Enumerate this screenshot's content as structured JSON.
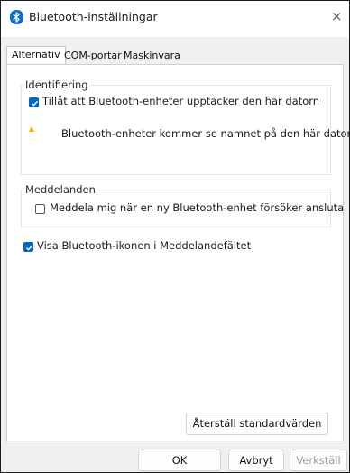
{
  "window": {
    "title": "Bluetooth-inställningar",
    "close_glyph": "×"
  },
  "tabs": [
    {
      "label": "Alternativ",
      "active": true
    },
    {
      "label": "COM-portar",
      "active": false
    },
    {
      "label": "Maskinvara",
      "active": false
    }
  ],
  "identification": {
    "group_title": "Identifiering",
    "allow_discovery_label": "Tillåt att Bluetooth-enheter upptäcker den här datorn",
    "allow_discovery_checked": true,
    "warning_text": "Bluetooth-enheter kommer se namnet på den här datorn."
  },
  "notifications": {
    "group_title": "Meddelanden",
    "notify_label": "Meddela mig när en ny Bluetooth-enhet försöker ansluta",
    "notify_checked": false
  },
  "show_icon": {
    "label": "Visa Bluetooth-ikonen i Meddelandefältet",
    "checked": true
  },
  "buttons": {
    "restore_defaults": "Återställ standardvärden",
    "ok": "OK",
    "cancel": "Avbryt",
    "apply": "Verkställ"
  },
  "colors": {
    "accent": "#0067c0",
    "warning": "#e3b300"
  },
  "icons": {
    "app": "bluetooth-icon",
    "warning": "warning-icon",
    "close": "close-icon"
  }
}
